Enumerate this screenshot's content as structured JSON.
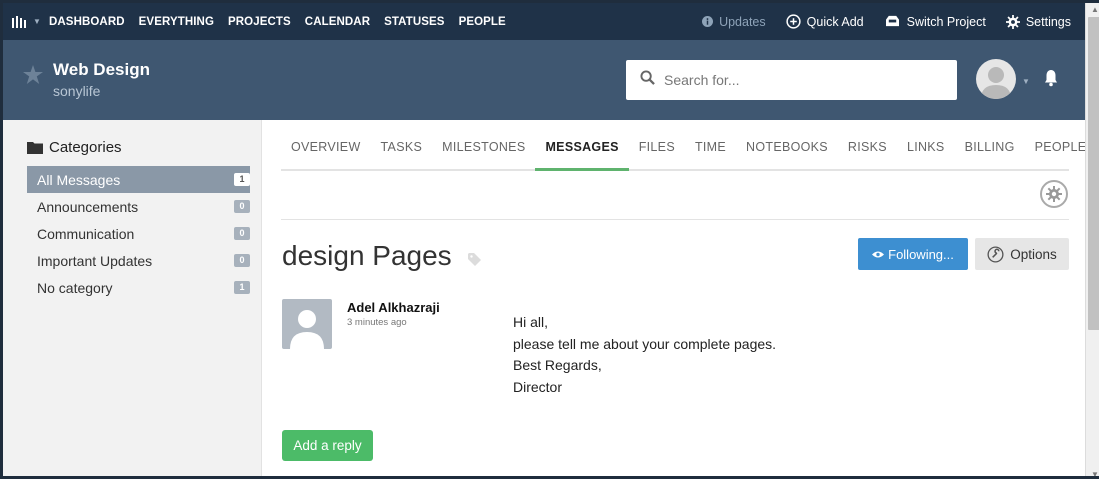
{
  "nav": {
    "logo_icon": "bars-logo-icon",
    "links": [
      "DASHBOARD",
      "EVERYTHING",
      "PROJECTS",
      "CALENDAR",
      "STATUSES",
      "PEOPLE"
    ],
    "updates": "Updates",
    "quick_add": "Quick Add",
    "switch_project": "Switch Project",
    "settings": "Settings"
  },
  "project": {
    "title": "Web Design",
    "subtitle": "sonylife",
    "search_placeholder": "Search for..."
  },
  "sidebar": {
    "heading": "Categories",
    "items": [
      {
        "label": "All Messages",
        "count": "1",
        "active": true
      },
      {
        "label": "Announcements",
        "count": "0"
      },
      {
        "label": "Communication",
        "count": "0"
      },
      {
        "label": "Important Updates",
        "count": "0"
      },
      {
        "label": "No category",
        "count": "1"
      }
    ]
  },
  "tabs": [
    "OVERVIEW",
    "TASKS",
    "MILESTONES",
    "MESSAGES",
    "FILES",
    "TIME",
    "NOTEBOOKS",
    "RISKS",
    "LINKS",
    "BILLING",
    "PEOPLE"
  ],
  "active_tab": "MESSAGES",
  "message": {
    "title": "design Pages",
    "following_label": "Following...",
    "options_label": "Options",
    "author": "Adel Alkhazraji",
    "time": "3 minutes ago",
    "lines": [
      "Hi all,",
      "please tell me about your complete pages.",
      "Best Regards,",
      "Director"
    ],
    "reply_label": "Add a reply"
  },
  "colors": {
    "topnav": "#1f3248",
    "header": "#3f5771",
    "accent_blue": "#3d8fd1",
    "accent_green": "#4cbb68",
    "tab_active": "#5fb36e"
  }
}
